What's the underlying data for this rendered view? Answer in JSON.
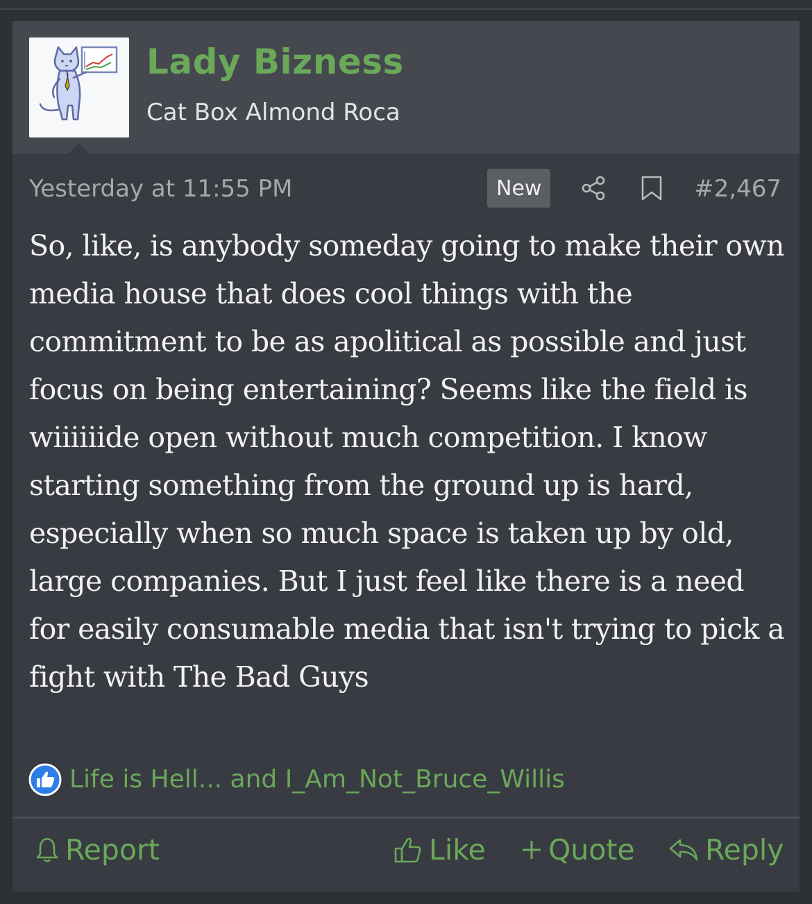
{
  "author": {
    "name": "Lady Bizness",
    "title": "Cat Box Almond Roca",
    "avatar_icon": "cat-presenting-chart-avatar"
  },
  "meta": {
    "date": "Yesterday at 11:55 PM",
    "new_badge": "New",
    "share_icon": "share-icon",
    "bookmark_icon": "bookmark-icon",
    "post_number": "#2,467"
  },
  "body": {
    "text": "So, like, is anybody someday going to make their own media house that does cool things with the commitment to be as apolitical as possible and just focus on being entertaining? Seems like the field is wiiiiiide open without much competition. I know starting something from the ground up is hard, especially when so much space is taken up by old, large companies. But I just feel like there is a need for easily consumable media that isn't trying to pick a fight with The Bad Guys"
  },
  "reactions": {
    "icon": "like-reaction-icon",
    "text": "Life is Hell... and I_Am_Not_Bruce_Willis"
  },
  "actions": {
    "report": "Report",
    "like": "Like",
    "quote": "Quote",
    "reply": "Reply"
  },
  "colors": {
    "accent_green": "#6aa85a",
    "header_bg": "#45484e",
    "post_bg": "#383b41",
    "page_bg": "#2d3035",
    "like_blue": "#2d7ee6"
  }
}
